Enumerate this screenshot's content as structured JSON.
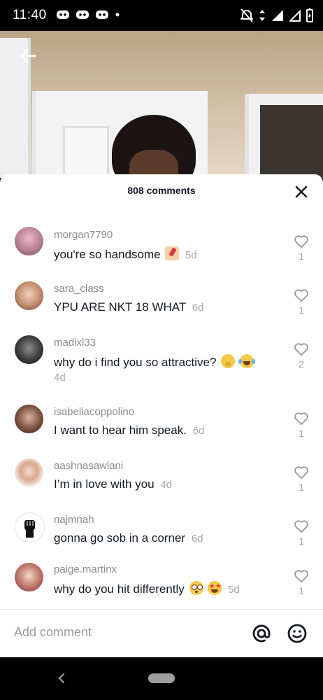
{
  "status_bar": {
    "time": "11:40"
  },
  "sheet": {
    "title": "808 comments"
  },
  "comments": [
    {
      "username": "morgan7790",
      "text": "you're so handsome",
      "time": "5d",
      "likes": "1"
    },
    {
      "username": "sara_class",
      "text": "YPU ARE NKT 18 WHAT",
      "time": "6d",
      "likes": "1"
    },
    {
      "username": "madixl33",
      "text": "why do i find you so attractive?",
      "time": "4d",
      "likes": "2"
    },
    {
      "username": "isabellacoppolino",
      "text": "I want to hear him speak.",
      "time": "6d",
      "likes": "1"
    },
    {
      "username": "aashnasawlani",
      "text": "I’m in love with you",
      "time": "4d",
      "likes": "1"
    },
    {
      "username": "najmnah",
      "text": "gonna go sob in a corner",
      "time": "6d",
      "likes": "1"
    },
    {
      "username": "paige.martinx",
      "text": "why do you hit differently",
      "time": "5d",
      "likes": "1"
    }
  ],
  "composer": {
    "placeholder": "Add comment"
  },
  "colors": {
    "text_primary": "#161823",
    "text_secondary": "#8a8b91",
    "sheet_bg": "#ffffff"
  }
}
